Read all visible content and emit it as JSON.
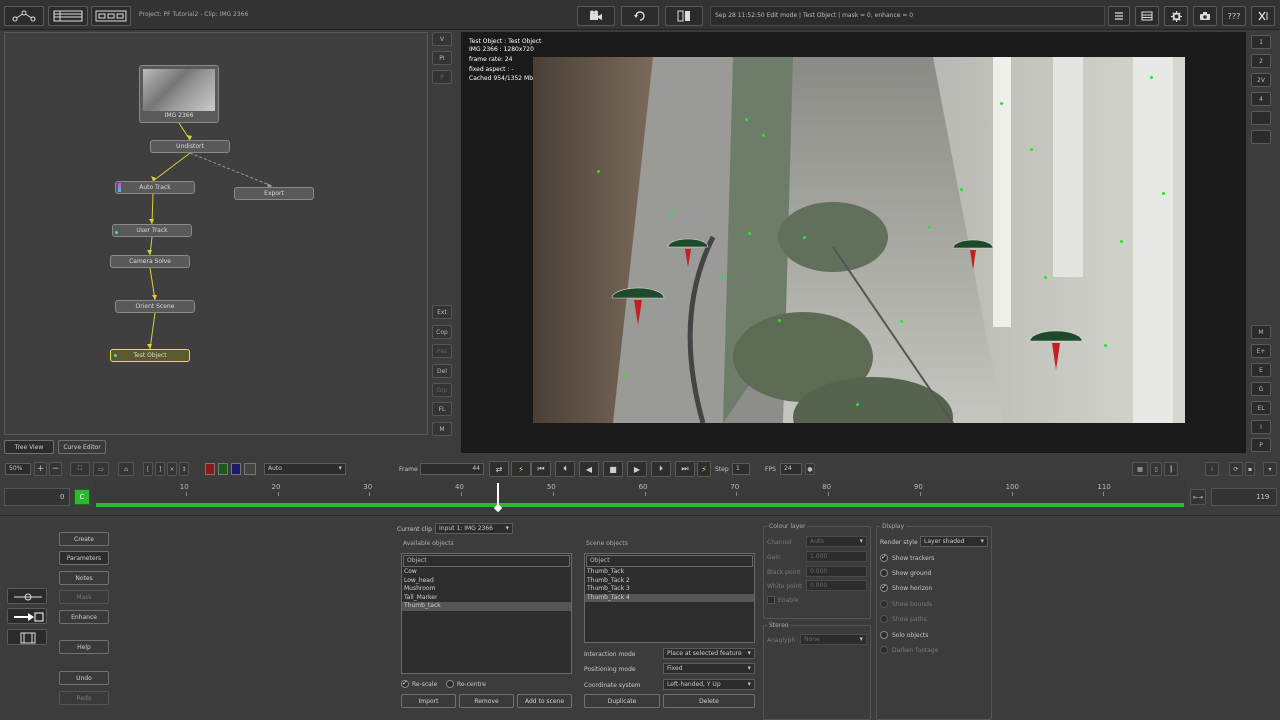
{
  "topbar": {
    "title": "Project: PF Tutorial2 - Clip: IMG 2366",
    "status": "Sep 28 11:52:50 Edit mode | Test Object | mask = 0, enhance = 0",
    "help_label": "???"
  },
  "node_editor": {
    "thumbnail_label": "IMG 2366",
    "nodes": {
      "undistort": "Undistort",
      "auto_track": "Auto Track",
      "export": "Export",
      "user_track": "User Track",
      "camera_solve": "Camera Solve",
      "orient_scene": "Orient Scene",
      "test_object": "Test Object"
    },
    "side_buttons": [
      "V",
      "PI",
      "P",
      "Ext",
      "Cop",
      "Pas",
      "Del",
      "Grp",
      "FL",
      "M"
    ],
    "tabs": {
      "tree_view": "Tree View",
      "curve_editor": "Curve Editor"
    }
  },
  "viewer": {
    "overlay_lines": [
      "Test Object : Test Object",
      "IMG 2366 : 1280x720",
      "frame rate: 24",
      "fixed aspect : -",
      "Cached 954/1352 Mb"
    ],
    "right_buttons": [
      "1",
      "2",
      "2V",
      "4",
      "",
      "",
      "M",
      "E+",
      "E",
      "G",
      "EL",
      "I",
      "P"
    ]
  },
  "playback": {
    "zoom": "50%",
    "channel": "Auto",
    "frame_label": "Frame",
    "frame_value": "44",
    "step_label": "Step",
    "step_value": "1",
    "fps_label": "FPS",
    "fps_value": "24"
  },
  "timeline": {
    "start_frame": "0",
    "current_marker": "C",
    "end_frame": "119",
    "ticks": [
      "10",
      "20",
      "30",
      "40",
      "50",
      "60",
      "70",
      "80",
      "90",
      "100",
      "110"
    ],
    "tick_values": [
      10,
      20,
      30,
      40,
      50,
      60,
      70,
      80,
      90,
      100,
      110
    ],
    "frame_min": 0,
    "frame_max": 119,
    "current_frame": 44
  },
  "left_panel": {
    "create": "Create",
    "parameters": "Parameters",
    "notes": "Notes",
    "mask": "Mask",
    "enhance": "Enhance",
    "help": "Help",
    "undo": "Undo",
    "redo": "Redo"
  },
  "params": {
    "current_clip_label": "Current clip",
    "current_clip_value": "Input 1: IMG 2366",
    "available_title": "Available objects",
    "available_header": "Object",
    "available_items": [
      "Cow",
      "Low_head",
      "Mushroom",
      "Tall_Marker",
      "Thumb_tack"
    ],
    "scene_title": "Scene objects",
    "scene_header": "Object",
    "scene_items": [
      "Thumb_Tack",
      "Thumb_Tack 2",
      "Thumb_Tack 3",
      "Thumb_Tack 4"
    ],
    "rescale_label": "Re-scale",
    "recentre_label": "Re-centre",
    "interaction_mode_label": "Interaction mode",
    "interaction_mode_value": "Place at selected feature",
    "positioning_mode_label": "Positioning mode",
    "positioning_mode_value": "Fixed",
    "coordinate_system_label": "Coordinate system",
    "coordinate_system_value": "Left-handed, Y Up",
    "import_btn": "Import",
    "remove_btn": "Remove",
    "add_btn": "Add to scene",
    "duplicate_btn": "Duplicate",
    "delete_btn": "Delete",
    "colour_title": "Colour layer",
    "channel_label": "Channel",
    "channel_value": "Auto",
    "gain_label": "Gain",
    "gain_value": "1.000",
    "black_label": "Black point",
    "black_value": "0.000",
    "white_label": "White point",
    "white_value": "0.000",
    "enable_label": "Enable",
    "stereo_title": "Stereo",
    "anaglyph_label": "Anaglyph",
    "anaglyph_value": "None",
    "display_title": "Display",
    "render_style_label": "Render style",
    "render_style_value": "Layer shaded",
    "show_trackers": "Show trackers",
    "show_ground": "Show ground",
    "show_horizon": "Show horizon",
    "show_bounds": "Show bounds",
    "show_paths": "Show paths",
    "solo_objects": "Solo objects",
    "darken_footage": "Darken footage"
  },
  "colors": {
    "accent_green": "#2fb82f",
    "node_selected": "#e8e23a",
    "link_yellow": "#d8d23a"
  }
}
